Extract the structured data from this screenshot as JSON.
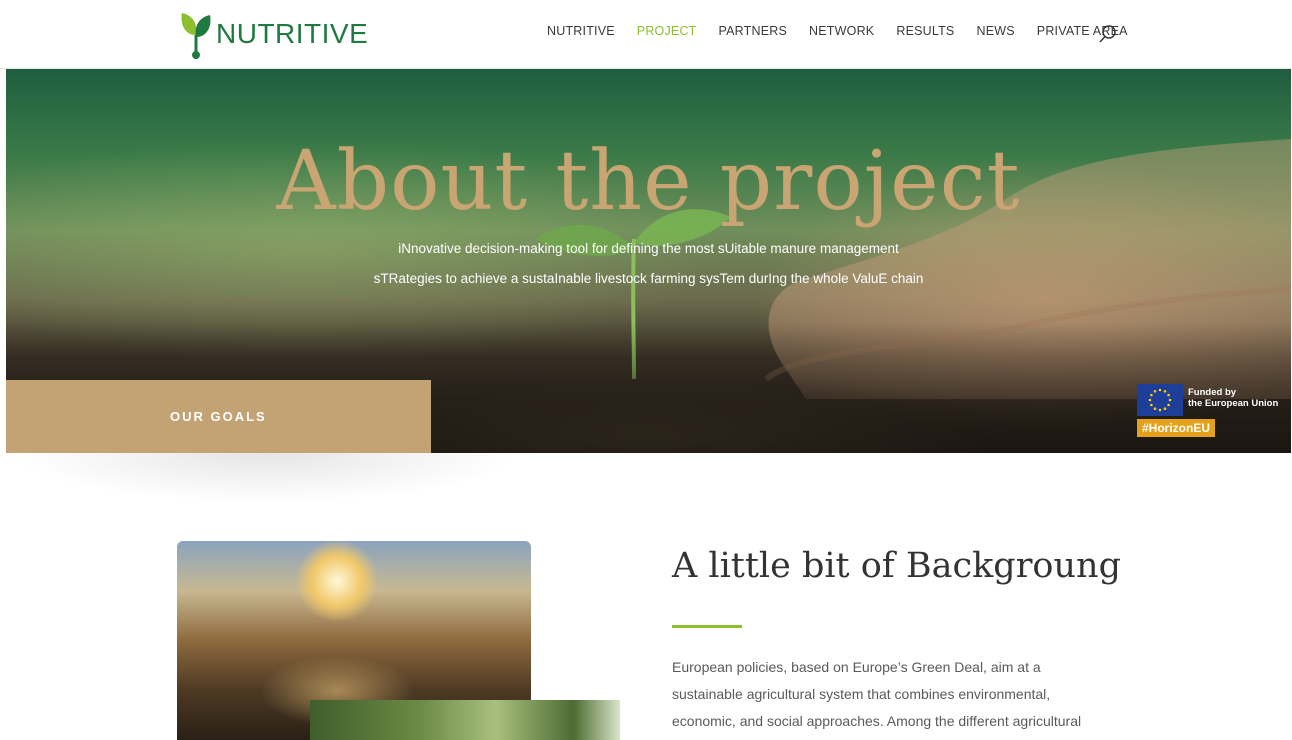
{
  "header": {
    "logo_text": "NUTRITIVE",
    "nav": [
      "NUTRITIVE",
      "PROJECT",
      "PARTNERS",
      "NETWORK",
      "RESULTS",
      "NEWS",
      "PRIVATE AREA"
    ],
    "active_nav": "PROJECT",
    "search_icon": "search-icon"
  },
  "hero": {
    "title": "About the project",
    "subtitle_line1": "iNnovative decision-making tool for defining the most sUitable manure management",
    "subtitle_line2": "sTRategies to achieve a sustaInable livestock farming sysTem durIng the whole ValuE chain",
    "goals_label": "OUR GOALS",
    "eu_funded_line1": "Funded by",
    "eu_funded_line2": "the European Union",
    "eu_tag": "#HorizonEU"
  },
  "background_section": {
    "title": "A little bit of Backgroung",
    "paragraph_lines": [
      "European policies, based on Europe’s Green Deal, aim at a",
      "sustainable agricultural system that combines environmental,",
      "economic, and social approaches. Among the different agricultural"
    ]
  },
  "colors": {
    "brand_green": "#1f7a3f",
    "nav_active": "#8bbf2d",
    "gold": "#c3a374",
    "hero_title": "#c8a572",
    "eu_blue": "#1d3f9a",
    "eu_orange": "#e3a21a"
  }
}
